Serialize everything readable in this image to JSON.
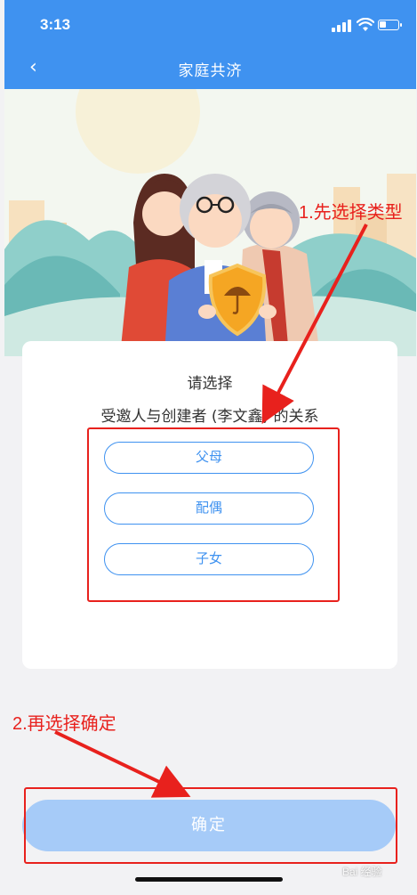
{
  "status_bar": {
    "time": "3:13"
  },
  "nav": {
    "back_glyph": "‹",
    "title": "家庭共济"
  },
  "card": {
    "prompt_line1": "请选择",
    "prompt_line2": "受邀人与创建者 (李文鑫) 的关系",
    "options": [
      {
        "label": "父母"
      },
      {
        "label": "配偶"
      },
      {
        "label": "子女"
      }
    ]
  },
  "confirm_label": "确定",
  "annotations": {
    "step1": "1.先选择类型",
    "step2": "2.再选择确定",
    "color": "#e8211d"
  },
  "watermark": "Bai 经验",
  "colors": {
    "primary": "#3f92f0",
    "confirm_disabled": "#a6cbf8"
  },
  "icons": [
    "back-chevron-icon",
    "signal-icon",
    "wifi-icon",
    "battery-icon",
    "umbrella-shield-icon"
  ]
}
